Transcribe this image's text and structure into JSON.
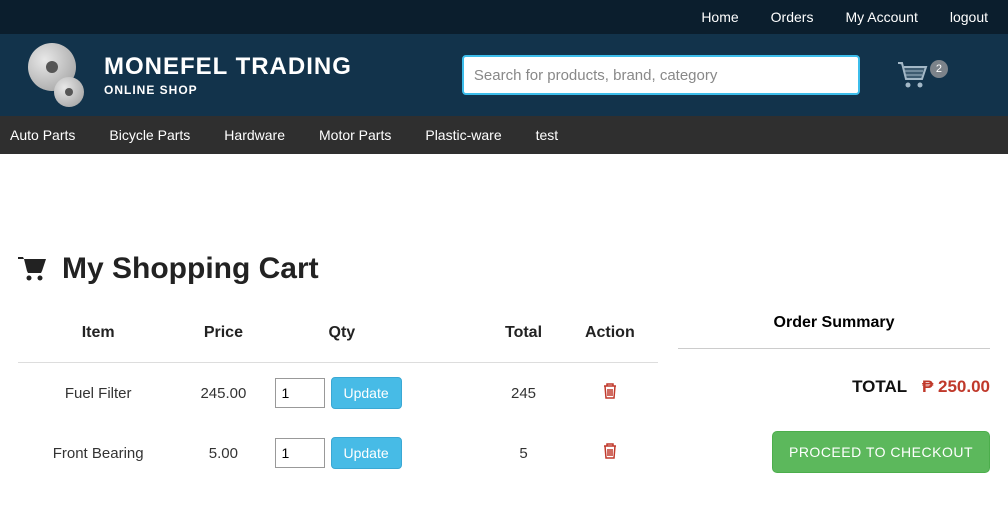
{
  "topnav": {
    "home": "Home",
    "orders": "Orders",
    "account": "My Account",
    "logout": "logout"
  },
  "brand": {
    "title": "MONEFEL TRADING",
    "subtitle": "ONLINE SHOP"
  },
  "search": {
    "placeholder": "Search for products, brand, category"
  },
  "cart_badge": "2",
  "categories": [
    "Auto Parts",
    "Bicycle Parts",
    "Hardware",
    "Motor Parts",
    "Plastic-ware",
    "test"
  ],
  "page": {
    "title": "My Shopping Cart"
  },
  "cart_table": {
    "headers": {
      "item": "Item",
      "price": "Price",
      "qty": "Qty",
      "total": "Total",
      "action": "Action"
    },
    "update_label": "Update",
    "rows": [
      {
        "item": "Fuel Filter",
        "price": "245.00",
        "qty": "1",
        "total": "245"
      },
      {
        "item": "Front Bearing",
        "price": "5.00",
        "qty": "1",
        "total": "5"
      }
    ]
  },
  "summary": {
    "title": "Order Summary",
    "total_label": "TOTAL",
    "total_amount": "₱ 250.00",
    "checkout_label": "PROCEED TO CHECKOUT"
  }
}
